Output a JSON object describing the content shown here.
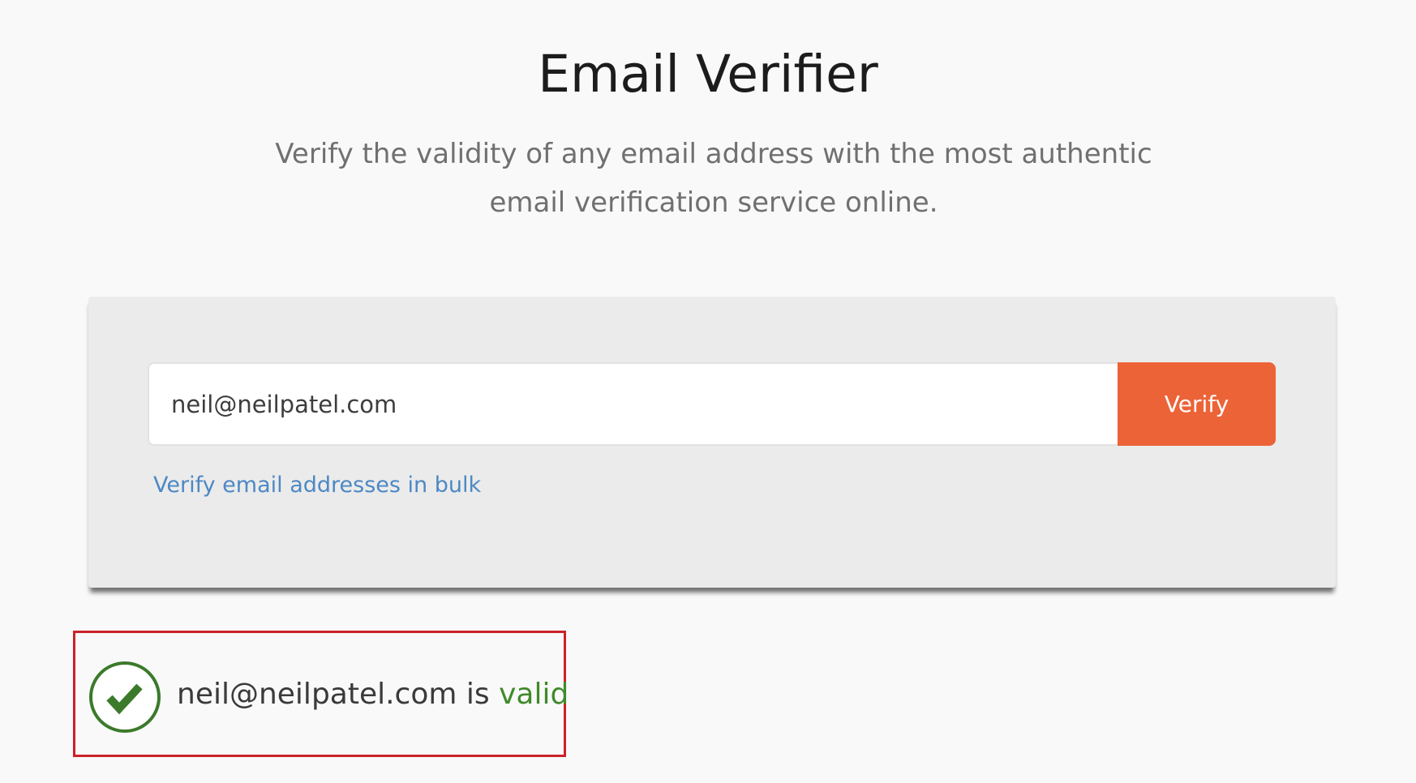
{
  "header": {
    "title": "Email Verifier",
    "subtitle": "Verify the validity of any email address with the most authentic email verification service online."
  },
  "form": {
    "email_value": "neil@neilpatel.com",
    "verify_label": "Verify",
    "bulk_link_label": "Verify email addresses in bulk"
  },
  "result": {
    "icon": "check-circle-icon",
    "email": "neil@neilpatel.com",
    "connector": " is ",
    "status": "valid"
  },
  "colors": {
    "accent_button": "#ec6337",
    "link": "#4d88c4",
    "valid_green": "#3f8a2a",
    "highlight_border": "#cc2229"
  }
}
